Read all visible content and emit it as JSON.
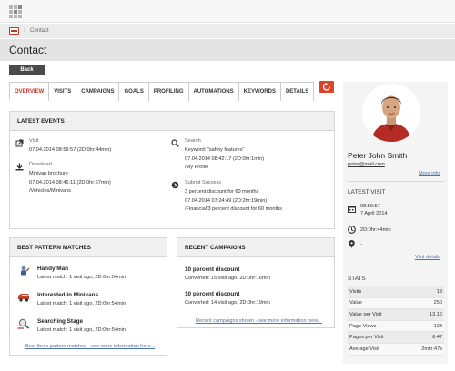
{
  "breadcrumb": {
    "current": "Contact",
    "separator": "›"
  },
  "page": {
    "title": "Contact",
    "back_label": "Back"
  },
  "tabs": [
    {
      "label": "OVERVIEW",
      "active": true
    },
    {
      "label": "VISITS"
    },
    {
      "label": "CAMPAIGNS"
    },
    {
      "label": "GOALS"
    },
    {
      "label": "PROFILING"
    },
    {
      "label": "AUTOMATIONS"
    },
    {
      "label": "KEYWORDS"
    },
    {
      "label": "DETAILS"
    }
  ],
  "latest_events": {
    "heading": "LATEST EVENTS",
    "visit": {
      "label": "Visit",
      "line1": "07.04.2014 08:59:57 (2D:0hr:44min)"
    },
    "download": {
      "label": "Download",
      "line1": "Minivan brochure",
      "line2": "07.04.2014 08:46:11 (2D:0hr:57min)",
      "line3": "/Vehicles/Minivans"
    },
    "search": {
      "label": "Search",
      "line1": "Keyword: \"safety features\"",
      "line2": "07.04.2014 08:42:17 (2D:0hr:1min)",
      "line3": "/My Profile"
    },
    "submit": {
      "label": "Submit Success",
      "line1": "3 percent discount for 60 months",
      "line2": "07.04.2014 07:24:49 (2D:2hr:19min)",
      "line3": "/Financial/3 percent discount for 60 months"
    }
  },
  "pattern_matches": {
    "heading": "BEST PATTERN MATCHES",
    "items": [
      {
        "title": "Handy Man",
        "sub": "Latest match: 1 visit ago, 2D:0hr:54min"
      },
      {
        "title": "Interested in Minivans",
        "sub": "Latest match: 1 visit ago, 2D:0hr:54min"
      },
      {
        "title": "Searching Stage",
        "sub": "Latest match: 1 visit ago, 2D:0hr:54min"
      }
    ],
    "more": "Best three pattern matches - see more information here..."
  },
  "recent_campaigns": {
    "heading": "RECENT CAMPAIGNS",
    "items": [
      {
        "title": "10 percent discount",
        "sub": "Converted: 15 visit ago, 2D:0hr:16min"
      },
      {
        "title": "10 percent discount",
        "sub": "Converted: 14 visit ago, 2D:0hr:19min"
      }
    ],
    "more": "Recent campaigns shown - see more information here..."
  },
  "profile": {
    "name": "Peter John Smith",
    "email": "peter@mail.com",
    "more_info": "More info"
  },
  "latest_visit": {
    "heading": "LATEST VISIT",
    "time": "08:59:57",
    "date": "7 April 2014",
    "duration": "2D:0hr:44min",
    "location": "-",
    "details_link": "Visit details"
  },
  "stats": {
    "heading": "STATS",
    "rows": [
      {
        "label": "Visits",
        "value": "19"
      },
      {
        "label": "Value",
        "value": "250"
      },
      {
        "label": "Value per Visit",
        "value": "13.16"
      },
      {
        "label": "Page Views",
        "value": "123"
      },
      {
        "label": "Pages per Visit",
        "value": "6.47"
      },
      {
        "label": "Average Visit",
        "value": "2min:47s"
      }
    ]
  },
  "colors": {
    "accent": "#d9452b",
    "link": "#4e73a6"
  }
}
